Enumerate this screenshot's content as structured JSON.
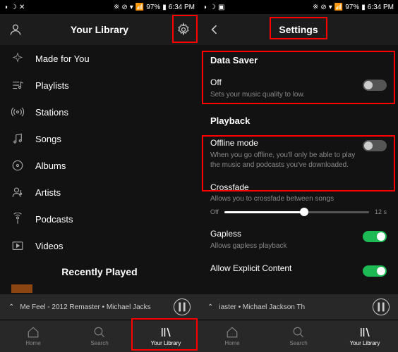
{
  "status": {
    "time": "6:34 PM",
    "battery": "97%"
  },
  "left": {
    "title": "Your Library",
    "items": [
      {
        "icon": "spark",
        "label": "Made for You"
      },
      {
        "icon": "playlist",
        "label": "Playlists"
      },
      {
        "icon": "radio",
        "label": "Stations"
      },
      {
        "icon": "song",
        "label": "Songs"
      },
      {
        "icon": "album",
        "label": "Albums"
      },
      {
        "icon": "artist",
        "label": "Artists"
      },
      {
        "icon": "podcast",
        "label": "Podcasts"
      },
      {
        "icon": "video",
        "label": "Videos"
      }
    ],
    "recently": "Recently Played",
    "nowplaying": "Me Feel - 2012 Remaster • Michael Jacks"
  },
  "right": {
    "title": "Settings",
    "dataSaver": {
      "heading": "Data Saver",
      "label": "Off",
      "desc": "Sets your music quality to low."
    },
    "playback": {
      "heading": "Playback"
    },
    "offline": {
      "label": "Offline mode",
      "desc": "When you go offline, you'll only be able to play the music and podcasts you've downloaded."
    },
    "crossfade": {
      "label": "Crossfade",
      "desc": "Allows you to crossfade between songs",
      "off": "Off",
      "max": "12 s"
    },
    "gapless": {
      "label": "Gapless",
      "desc": "Allows gapless playback"
    },
    "explicit": {
      "label": "Allow Explicit Content"
    },
    "nowplaying": "iaster • Michael Jackson          Th"
  },
  "nav": {
    "home": "Home",
    "search": "Search",
    "library": "Your Library"
  }
}
